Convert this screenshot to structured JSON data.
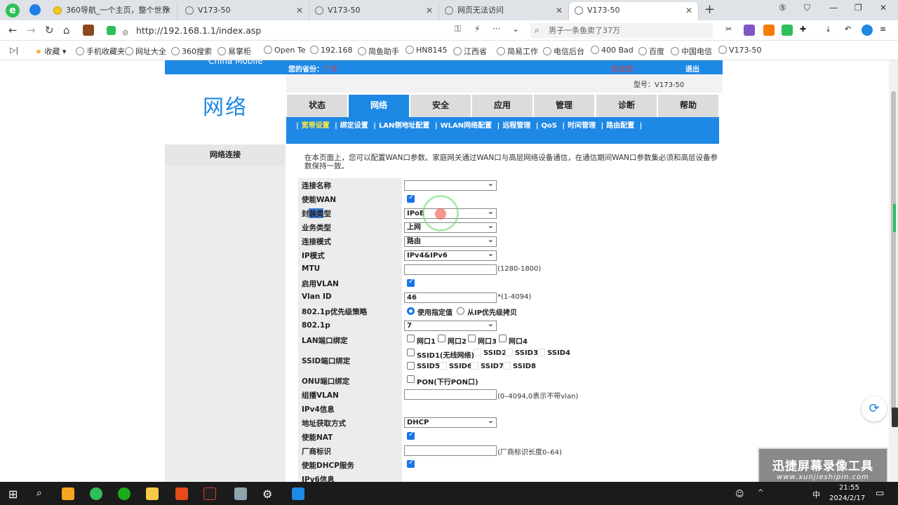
{
  "browser": {
    "tabs": [
      {
        "label": "360导航_一个主页，整个世界",
        "active": false
      },
      {
        "label": "V173-50",
        "active": false
      },
      {
        "label": "V173-50",
        "active": false
      },
      {
        "label": "网页无法访问",
        "active": false
      },
      {
        "label": "V173-50",
        "active": true
      }
    ],
    "new_tab": "+",
    "url": "http://192.168.1.1/index.asp",
    "search_placeholder": "男子一条鱼卖了37万",
    "bookmarks": [
      "收藏",
      "手机收藏夹",
      "网址大全",
      "360搜索",
      "易掌柜",
      "Open Te",
      "192.168",
      "简鱼助手",
      "HN8145",
      "江西省",
      "简易工作",
      "电信后台",
      "400 Bad",
      "百度",
      "中国电信",
      "V173-50"
    ]
  },
  "router": {
    "brand": "China Mobile",
    "province_label": "您的省份：",
    "province_value": "广东",
    "welcome": "欢迎您！",
    "logout": "退出",
    "model": "型号：V173-50",
    "section_title": "网络",
    "left_nav": "网络连接",
    "main_tabs": [
      "状态",
      "网络",
      "安全",
      "应用",
      "管理",
      "诊断",
      "帮助"
    ],
    "active_tab": "网络",
    "sub_tabs": [
      "宽带设置",
      "绑定设置",
      "LAN侧地址配置",
      "WLAN网络配置",
      "远程管理",
      "QoS",
      "时间管理",
      "路由配置"
    ],
    "intro": "在本页面上，您可以配置WAN口参数。家庭网关通过WAN口与高层网络设备通信，在通信期间WAN口参数集必须和高层设备参数保持一致。"
  },
  "form": {
    "conn_name": {
      "label": "连接名称",
      "value": ""
    },
    "enable_wan": {
      "label": "使能WAN",
      "checked": true
    },
    "encap": {
      "label": "封装类型",
      "value": "IPoE"
    },
    "service": {
      "label": "业务类型",
      "value": "上网"
    },
    "conn_mode": {
      "label": "连接模式",
      "value": "路由"
    },
    "ip_mode": {
      "label": "IP模式",
      "value": "IPv4&IPv6"
    },
    "mtu": {
      "label": "MTU",
      "value": "",
      "hint": "(1280-1800)"
    },
    "enable_vlan": {
      "label": "启用VLAN",
      "checked": true
    },
    "vlan_id": {
      "label": "Vlan ID",
      "value": "46",
      "hint": "*(1-4094)"
    },
    "prio_policy": {
      "label": "802.1p优先级策略",
      "opt1": "使用指定值",
      "opt2": "从IP优先级拷贝"
    },
    "p8021": {
      "label": "802.1p",
      "value": "7"
    },
    "lan_bind": {
      "label": "LAN端口绑定",
      "ports": [
        "网口1",
        "网口2",
        "网口3",
        "网口4"
      ]
    },
    "ssid_bind": {
      "label": "SSID端口绑定",
      "row1": [
        "SSID1(无线网络)",
        "SSID2",
        "SSID3",
        "SSID4"
      ],
      "row2": [
        "SSID5",
        "SSID6",
        "SSID7",
        "SSID8"
      ]
    },
    "onu_bind": {
      "label": "ONU端口绑定",
      "port": "PON(下行PON口)"
    },
    "mcast_vlan": {
      "label": "组播VLAN",
      "value": "",
      "hint": "(0–4094,0表示不带vlan)"
    },
    "ipv4_info": {
      "label": "IPv4信息"
    },
    "addr_mode": {
      "label": "地址获取方式",
      "value": "DHCP"
    },
    "enable_nat": {
      "label": "使能NAT",
      "checked": true
    },
    "vendor_id": {
      "label": "厂商标识",
      "value": "",
      "hint": "(厂商标识长度0–64)"
    },
    "enable_dhcp": {
      "label": "使能DHCP服务",
      "checked": true
    },
    "ipv6_info": {
      "label": "IPv6信息"
    }
  },
  "watermark": {
    "line1": "迅捷屏幕录像工具",
    "line2": "www.xunjieshipin.com"
  },
  "taskbar": {
    "time": "21:55",
    "date": "2024/2/17",
    "ime": "中"
  }
}
